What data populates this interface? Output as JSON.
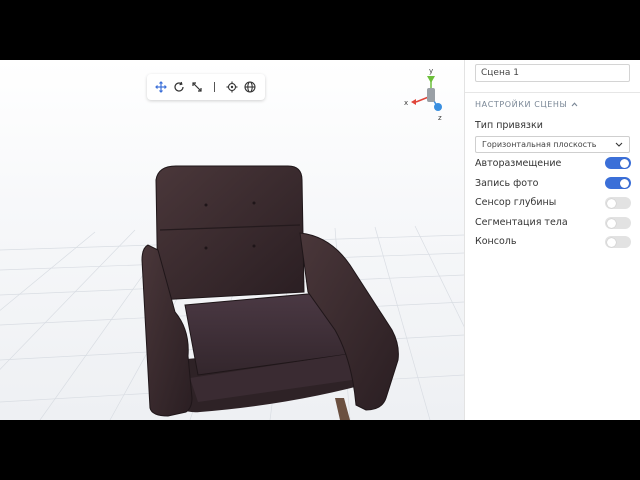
{
  "panel": {
    "scene_name": "Сцена 1",
    "section_title": "НАСТРОЙКИ СЦЕНЫ",
    "anchor_type_label": "Тип привязки",
    "anchor_type_value": "Горизонтальная плоскость",
    "toggles": [
      {
        "label": "Авторазмещение",
        "on": true
      },
      {
        "label": "Запись фото",
        "on": true
      },
      {
        "label": "Сенсор глубины",
        "on": false
      },
      {
        "label": "Сегментация тела",
        "on": false
      },
      {
        "label": "Консоль",
        "on": false
      }
    ]
  },
  "gizmo": {
    "x": "x",
    "y": "y",
    "z": "z"
  },
  "toolbar": {
    "tools": [
      "move-icon",
      "rotate-icon",
      "scale-icon",
      "target-icon",
      "globe-icon"
    ]
  },
  "colors": {
    "accent": "#3b6fd8",
    "axis_x": "#e0453a",
    "axis_y": "#6cbf3a",
    "axis_z": "#3a8fe0",
    "chair": "#3a2a2e"
  }
}
